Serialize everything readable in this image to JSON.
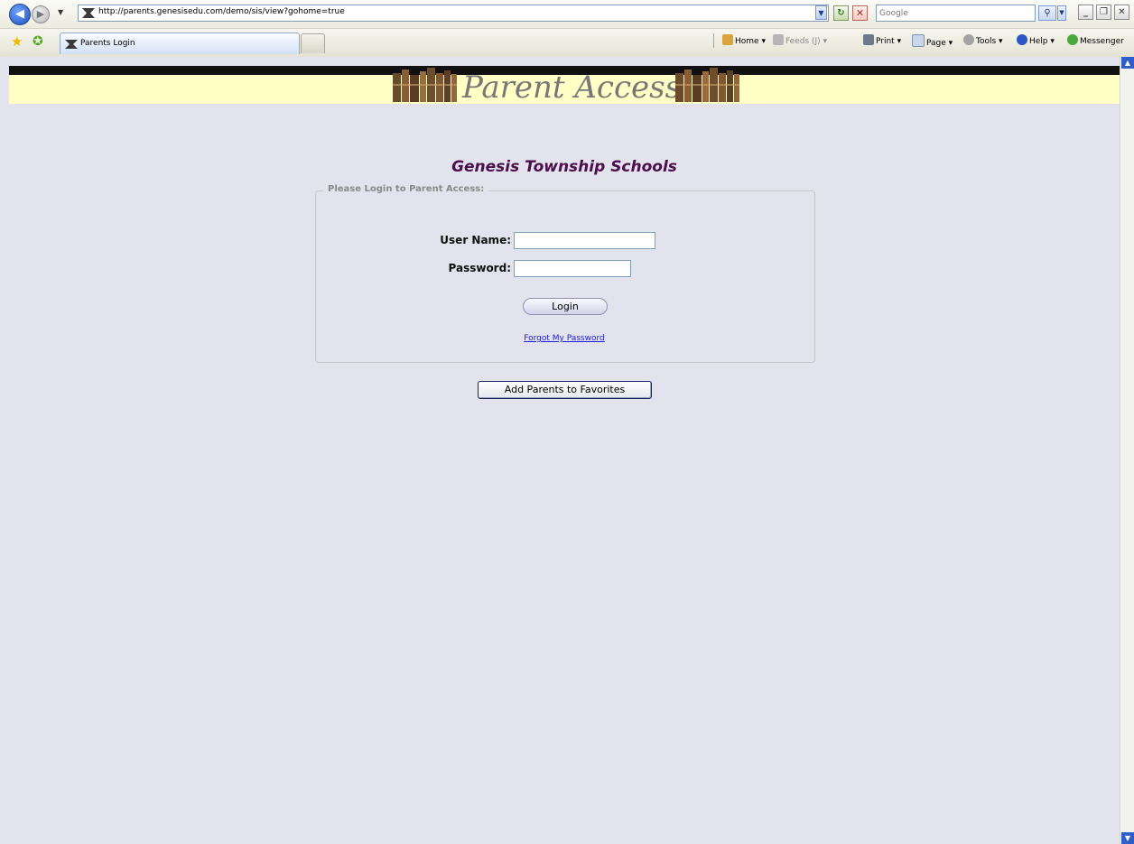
{
  "browser": {
    "url": "http://parents.genesisedu.com/demo/sis/view?gohome=true",
    "search_placeholder": "Google",
    "tab_title": "Parents Login",
    "command_bar": {
      "home": "Home",
      "feeds": "Feeds (J)",
      "print": "Print",
      "page": "Page",
      "tools": "Tools",
      "help": "Help",
      "messenger": "Messenger"
    },
    "icons": {
      "back": "back-arrow-icon",
      "forward": "forward-arrow-icon",
      "refresh": "refresh-icon",
      "stop": "stop-icon",
      "search": "search-icon",
      "favorites": "star-icon",
      "add_favorite": "add-favorite-icon",
      "minimize": "minimize-icon",
      "maximize": "restore-icon",
      "close": "close-icon"
    }
  },
  "page": {
    "banner_title": "Parent Access",
    "school_name": "Genesis Township Schools",
    "login_legend": "Please Login to Parent Access:",
    "username_label": "User Name:",
    "username_value": "",
    "password_label": "Password:",
    "password_value": "",
    "login_button": "Login",
    "forgot_link": "Forgot My Password",
    "favorites_button": "Add Parents to Favorites"
  },
  "colors": {
    "page_bg": "#e3e3ed",
    "banner_yellow": "#ffffc6",
    "school_name": "#4b0f4b",
    "link": "#1a1ae0"
  }
}
